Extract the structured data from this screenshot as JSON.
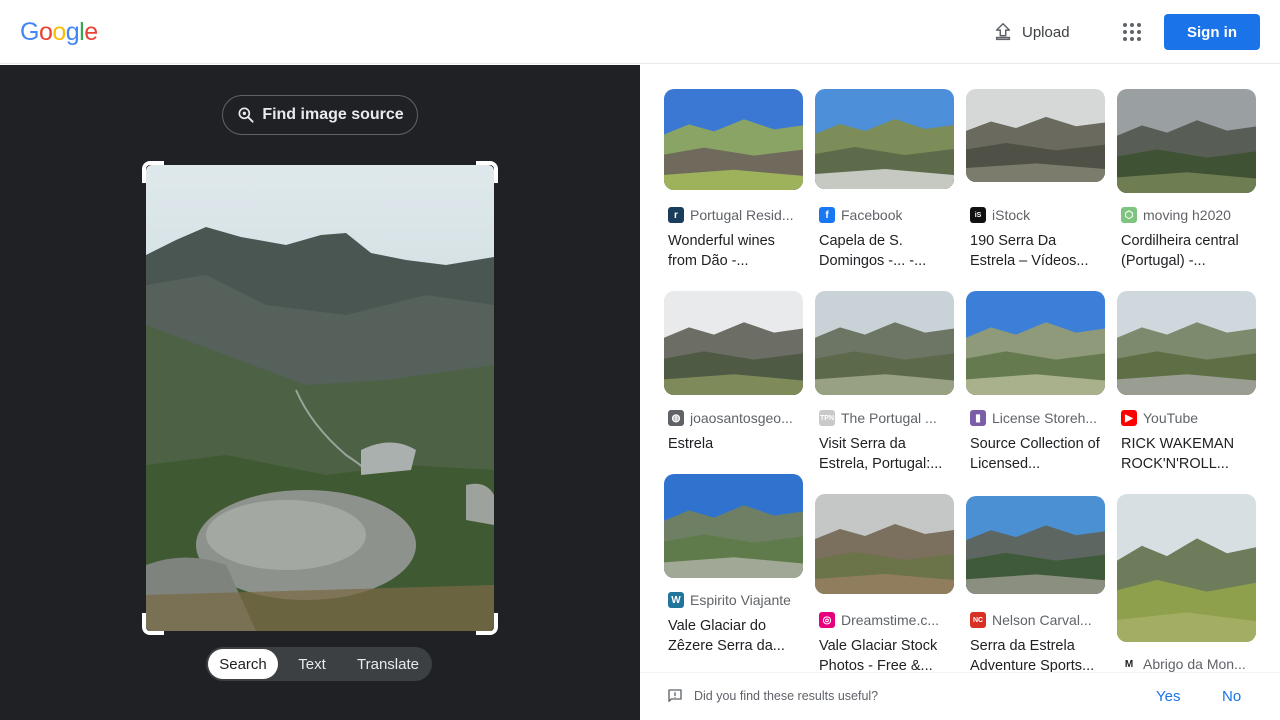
{
  "header": {
    "logo_letters": [
      {
        "ch": "G",
        "color": "#4285F4"
      },
      {
        "ch": "o",
        "color": "#EA4335"
      },
      {
        "ch": "o",
        "color": "#FBBC05"
      },
      {
        "ch": "g",
        "color": "#4285F4"
      },
      {
        "ch": "l",
        "color": "#34A853"
      },
      {
        "ch": "e",
        "color": "#EA4335"
      }
    ],
    "upload_label": "Upload",
    "apps_icon": "apps-grid-icon",
    "signin_label": "Sign in"
  },
  "left_panel": {
    "find_source_label": "Find image source",
    "modes": [
      "Search",
      "Text",
      "Translate"
    ],
    "active_mode": "Search"
  },
  "results": [
    {
      "source": "Portugal Resid...",
      "title": "Wonderful wines from Dão -...",
      "favicon": {
        "glyph": "r",
        "bg": "#1a3d5c"
      }
    },
    {
      "source": "Facebook",
      "title": "Capela de S. Domingos -... -...",
      "favicon": {
        "glyph": "f",
        "bg": "#1877F2"
      }
    },
    {
      "source": "iStock",
      "title": "190 Serra Da Estrela – Vídeos...",
      "favicon": {
        "glyph": "iS",
        "bg": "#111111"
      }
    },
    {
      "source": "moving h2020",
      "title": "Cordilheira central (Portugal) -...",
      "favicon": {
        "glyph": "⬡",
        "bg": "#7cc47f"
      }
    },
    {
      "source": "joaosantosgeo...",
      "title": "Estrela",
      "favicon": {
        "glyph": "◍",
        "bg": "#5f6368"
      }
    },
    {
      "source": "The Portugal ...",
      "title": "Visit Serra da Estrela, Portugal:...",
      "favicon": {
        "glyph": "TPN",
        "bg": "#c9c9c9"
      }
    },
    {
      "source": "License Storeh...",
      "title": "Source Collection of Licensed...",
      "favicon": {
        "glyph": "▮",
        "bg": "#7b5ea7"
      }
    },
    {
      "source": "YouTube",
      "title": "RICK WAKEMAN ROCK'N'ROLL...",
      "favicon": {
        "glyph": "▶",
        "bg": "#FF0000"
      }
    },
    {
      "source": "Espirito Viajante",
      "title": "Vale Glaciar do Zêzere Serra da...",
      "favicon": {
        "glyph": "W",
        "bg": "#21759b"
      }
    },
    {
      "source": "Dreamstime.c...",
      "title": "Vale Glaciar Stock Photos - Free &...",
      "favicon": {
        "glyph": "◎",
        "bg": "#e6007e"
      }
    },
    {
      "source": "Nelson Carval...",
      "title": "Serra da Estrela Adventure Sports...",
      "favicon": {
        "glyph": "NC",
        "bg": "#d93025"
      }
    },
    {
      "source": "Abrigo da Mon...",
      "title": "",
      "favicon": {
        "glyph": "M",
        "bg": "#ffffff"
      }
    }
  ],
  "feedback": {
    "question": "Did you find these results useful?",
    "yes": "Yes",
    "no": "No"
  }
}
